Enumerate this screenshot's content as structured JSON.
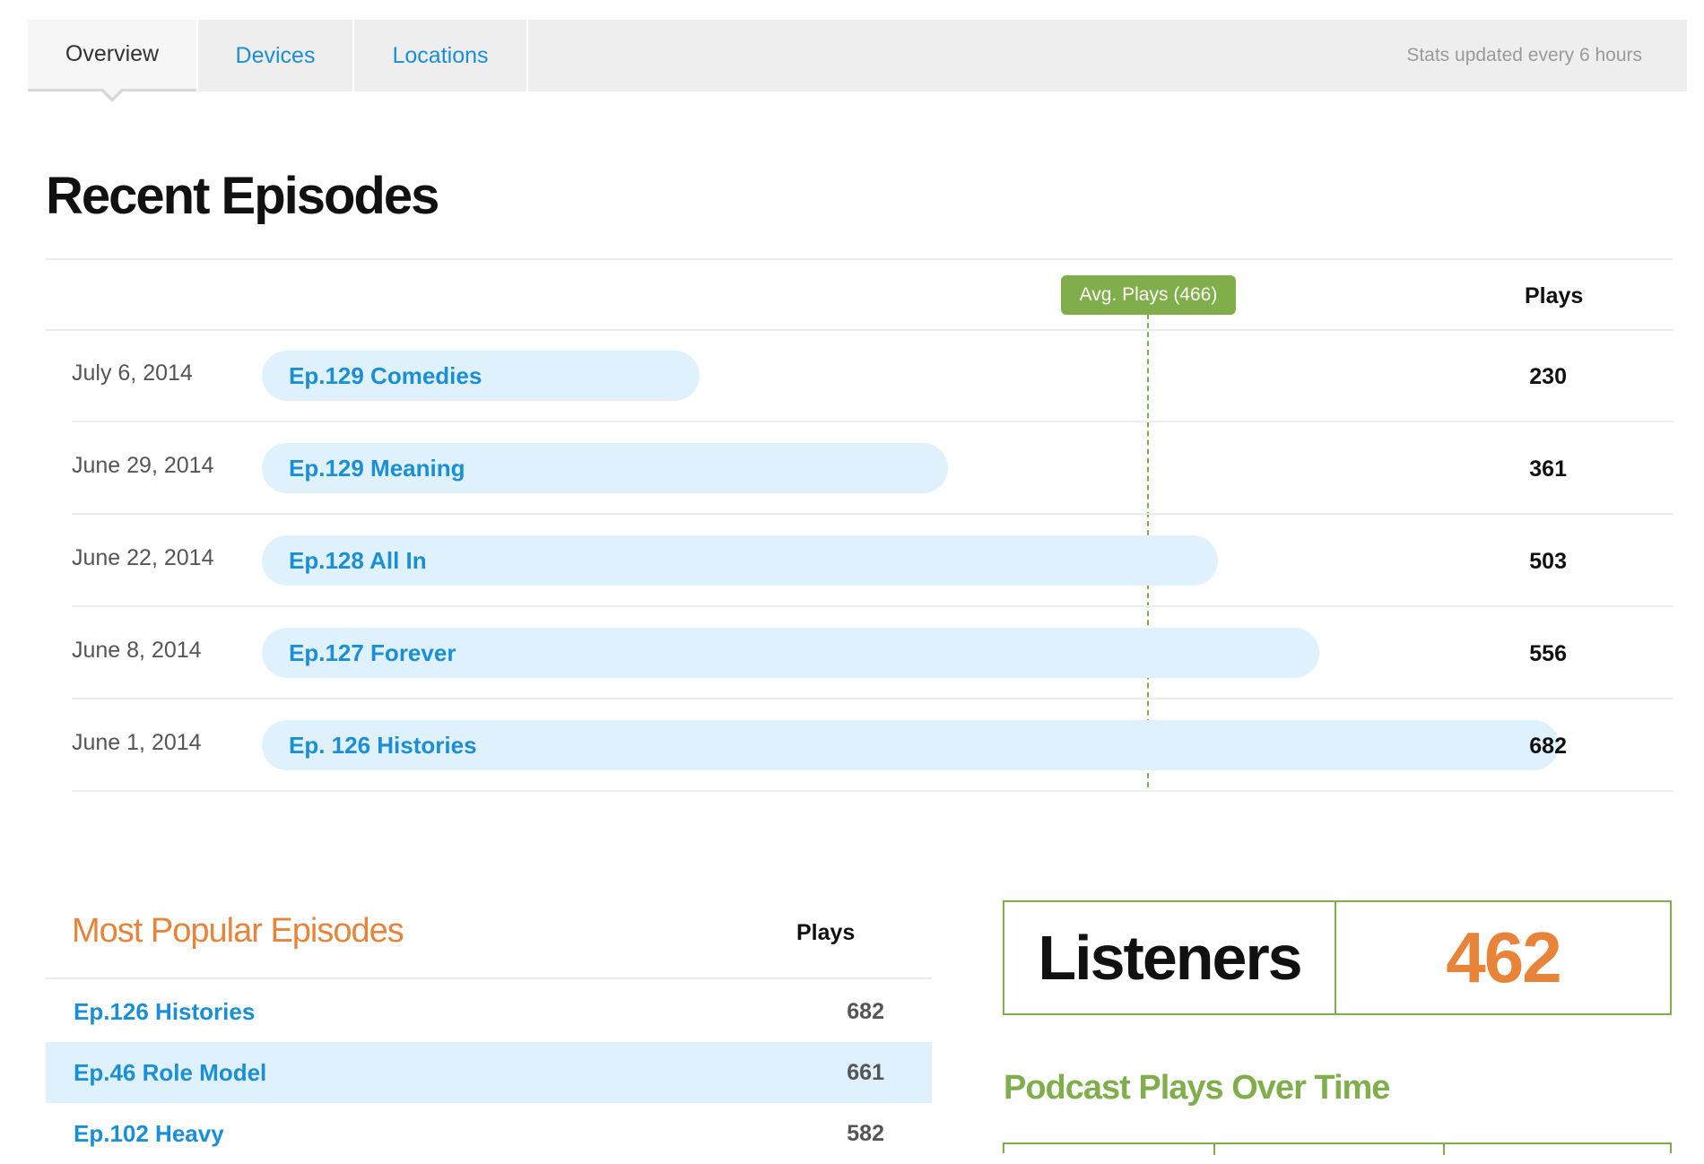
{
  "tabs": [
    {
      "label": "Overview",
      "active": true
    },
    {
      "label": "Devices",
      "active": false
    },
    {
      "label": "Locations",
      "active": false
    }
  ],
  "stats_note": "Stats updated every 6 hours",
  "recent": {
    "title": "Recent Episodes",
    "plays_header": "Plays",
    "avg_label": "Avg. Plays (466)",
    "avg_value": 466,
    "episodes": [
      {
        "date": "July 6, 2014",
        "title": "Ep.129 Comedies",
        "plays": 230
      },
      {
        "date": "June 29, 2014",
        "title": "Ep.129 Meaning",
        "plays": 361
      },
      {
        "date": "June 22, 2014",
        "title": "Ep.128 All In",
        "plays": 503
      },
      {
        "date": "June 8, 2014",
        "title": "Ep.127 Forever",
        "plays": 556
      },
      {
        "date": "June 1, 2014",
        "title": "Ep. 126 Histories",
        "plays": 682
      }
    ]
  },
  "popular": {
    "title": "Most Popular Episodes",
    "plays_header": "Plays",
    "episodes": [
      {
        "title": "Ep.126 Histories",
        "plays": 682
      },
      {
        "title": "Ep.46 Role Model",
        "plays": 661
      },
      {
        "title": "Ep.102 Heavy",
        "plays": 582
      }
    ]
  },
  "listeners": {
    "label": "Listeners",
    "value": "462"
  },
  "plays_over_time": {
    "title": "Podcast Plays Over Time"
  },
  "colors": {
    "link_blue": "#1a8fd6",
    "bar_bg": "#dff1fd",
    "accent_green": "#7fae4a",
    "accent_orange": "#e8833a"
  }
}
